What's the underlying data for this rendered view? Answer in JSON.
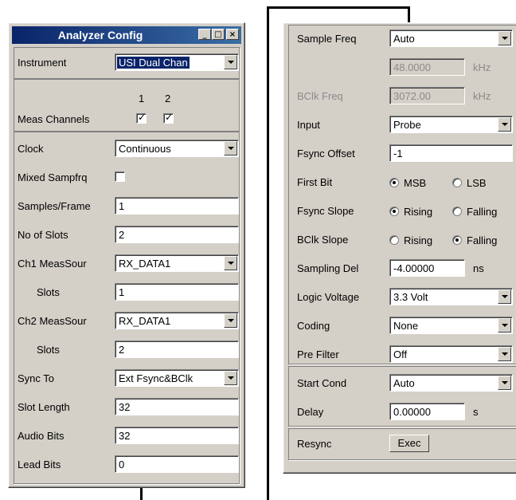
{
  "left_panel": {
    "title": "Analyzer Config",
    "window_buttons": {
      "minimize": "_",
      "maximize": "□",
      "close": "×"
    },
    "instrument": {
      "label": "Instrument",
      "value": "USI Dual Chan"
    },
    "meas_channels": {
      "label": "Meas Channels",
      "ch1": "1",
      "ch2": "2",
      "ch1_checked": true,
      "ch2_checked": true
    },
    "clock": {
      "label": "Clock",
      "value": "Continuous"
    },
    "mixed_sampfrq": {
      "label": "Mixed Sampfrq",
      "checked": false
    },
    "samples_frame": {
      "label": "Samples/Frame",
      "value": "1"
    },
    "no_of_slots": {
      "label": "No of Slots",
      "value": "2"
    },
    "ch1_meassour": {
      "label": "Ch1 MeasSour",
      "value": "RX_DATA1"
    },
    "ch1_slots": {
      "label": "Slots",
      "value": "1"
    },
    "ch2_meassour": {
      "label": "Ch2 MeasSour",
      "value": "RX_DATA1"
    },
    "ch2_slots": {
      "label": "Slots",
      "value": "2"
    },
    "sync_to": {
      "label": "Sync To",
      "value": "Ext Fsync&BClk"
    },
    "slot_length": {
      "label": "Slot Length",
      "value": "32"
    },
    "audio_bits": {
      "label": "Audio Bits",
      "value": "32"
    },
    "lead_bits": {
      "label": "Lead Bits",
      "value": "0"
    }
  },
  "right_panel": {
    "sample_freq": {
      "label": "Sample Freq",
      "value": "Auto"
    },
    "sample_freq_value": {
      "value": "48.0000",
      "unit": "kHz"
    },
    "bclk_freq": {
      "label": "BClk Freq",
      "value": "3072.00",
      "unit": "kHz"
    },
    "input": {
      "label": "Input",
      "value": "Probe"
    },
    "fsync_offset": {
      "label": "Fsync Offset",
      "value": "-1"
    },
    "first_bit": {
      "label": "First Bit",
      "option1": "MSB",
      "option2": "LSB",
      "selected": "MSB"
    },
    "fsync_slope": {
      "label": "Fsync Slope",
      "option1": "Rising",
      "option2": "Falling",
      "selected": "Rising"
    },
    "bclk_slope": {
      "label": "BClk Slope",
      "option1": "Rising",
      "option2": "Falling",
      "selected": "Falling"
    },
    "sampling_del": {
      "label": "Sampling Del",
      "value": "-4.00000",
      "unit": "ns"
    },
    "logic_voltage": {
      "label": "Logic Voltage",
      "value": "3.3 Volt"
    },
    "coding": {
      "label": "Coding",
      "value": "None"
    },
    "pre_filter": {
      "label": "Pre Filter",
      "value": "Off"
    },
    "start_cond": {
      "label": "Start Cond",
      "value": "Auto"
    },
    "delay": {
      "label": "Delay",
      "value": "0.00000",
      "unit": "s"
    },
    "resync": {
      "label": "Resync",
      "button": "Exec"
    }
  }
}
